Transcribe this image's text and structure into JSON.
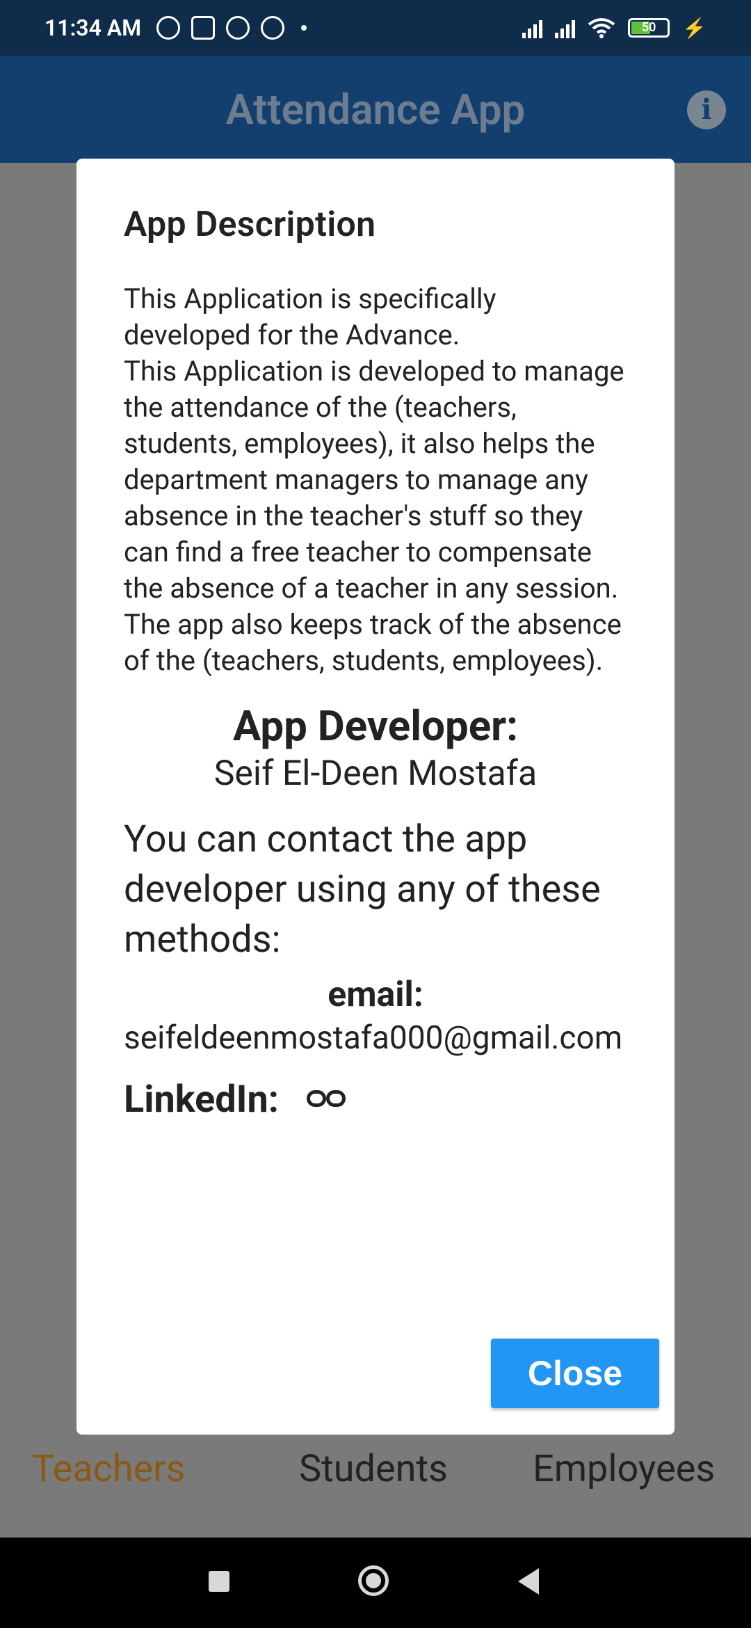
{
  "status_bar": {
    "time": "11:34 AM",
    "battery": "50"
  },
  "app_bar": {
    "title": "Attendance App",
    "info_icon": "info-icon"
  },
  "bottom_nav": {
    "items": [
      {
        "label": "Teachers",
        "active": true
      },
      {
        "label": "Students",
        "active": false
      },
      {
        "label": "Employees",
        "active": false
      }
    ]
  },
  "dialog": {
    "title": "App Description",
    "description": "This Application is specifically developed for the Advance.\nThis Application is developed to manage the attendance of the (teachers, students, employees), it also helps the department managers to manage any absence in the teacher's stuff so they can find a free teacher to compensate the absence of a teacher in any session.\nThe app also keeps track of the absence of the (teachers, students, employees).",
    "developer_label": "App Developer:",
    "developer_name": "Seif El-Deen Mostafa",
    "contact_text": "You can contact the app developer using any of these methods:",
    "email_label": "email:",
    "email": "seifeldeenmostafa000@gmail.com",
    "linkedin_label": "LinkedIn:",
    "close_label": "Close"
  },
  "colors": {
    "primary": "#133f6e",
    "accent_button": "#2196f3",
    "active_nav": "#8a5a14"
  }
}
